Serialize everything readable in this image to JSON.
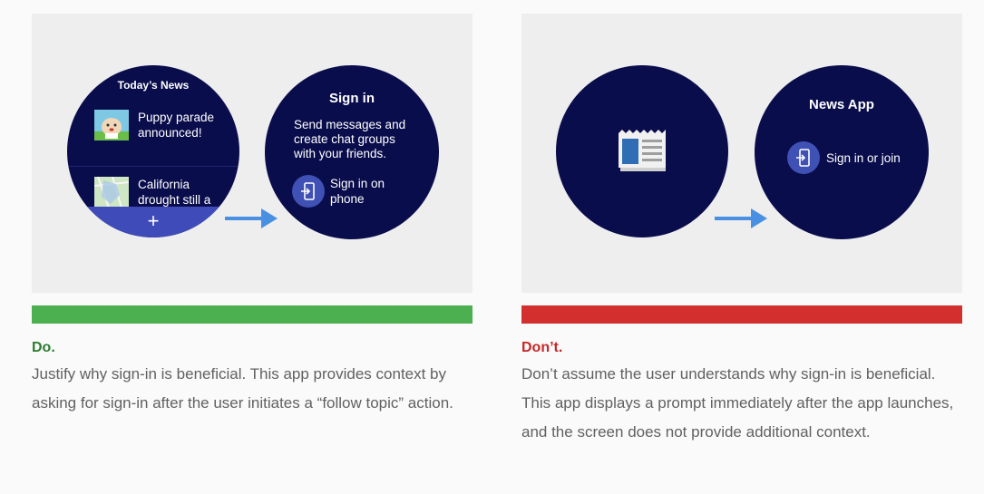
{
  "do_card": {
    "verdict": "Do.",
    "verdict_color": "#2e7d32",
    "bar_color": "#4caf50",
    "description": "Justify why sign-in is beneficial. This app provides context by asking for sign-in after the user initiates a “follow topic” action.",
    "watch1": {
      "title": "Today’s News",
      "items": [
        {
          "text": "Puppy parade announced!",
          "icon": "puppy-thumbnail"
        },
        {
          "text": "California drought still a",
          "icon": "map-thumbnail"
        }
      ],
      "fab_label": "+"
    },
    "watch2": {
      "title": "Sign in",
      "body": "Send messages and create chat groups with your friends.",
      "button_label": "Sign in on phone",
      "button_icon": "phone-sign-in-icon"
    }
  },
  "dont_card": {
    "verdict": "Don’t.",
    "verdict_color": "#c62828",
    "bar_color": "#d32f2f",
    "description": "Don’t assume the user understands why sign-in is beneficial. This app displays a prompt immediately after the app launches, and the screen does not provide additional context.",
    "watch1": {
      "icon": "newspaper-icon"
    },
    "watch2": {
      "title": "News App",
      "button_label": "Sign in or join",
      "button_icon": "phone-sign-in-icon"
    }
  },
  "colors": {
    "watch_background": "#0a0d4c",
    "accent_button": "#3f51b5",
    "arrow": "#4a90e2"
  }
}
